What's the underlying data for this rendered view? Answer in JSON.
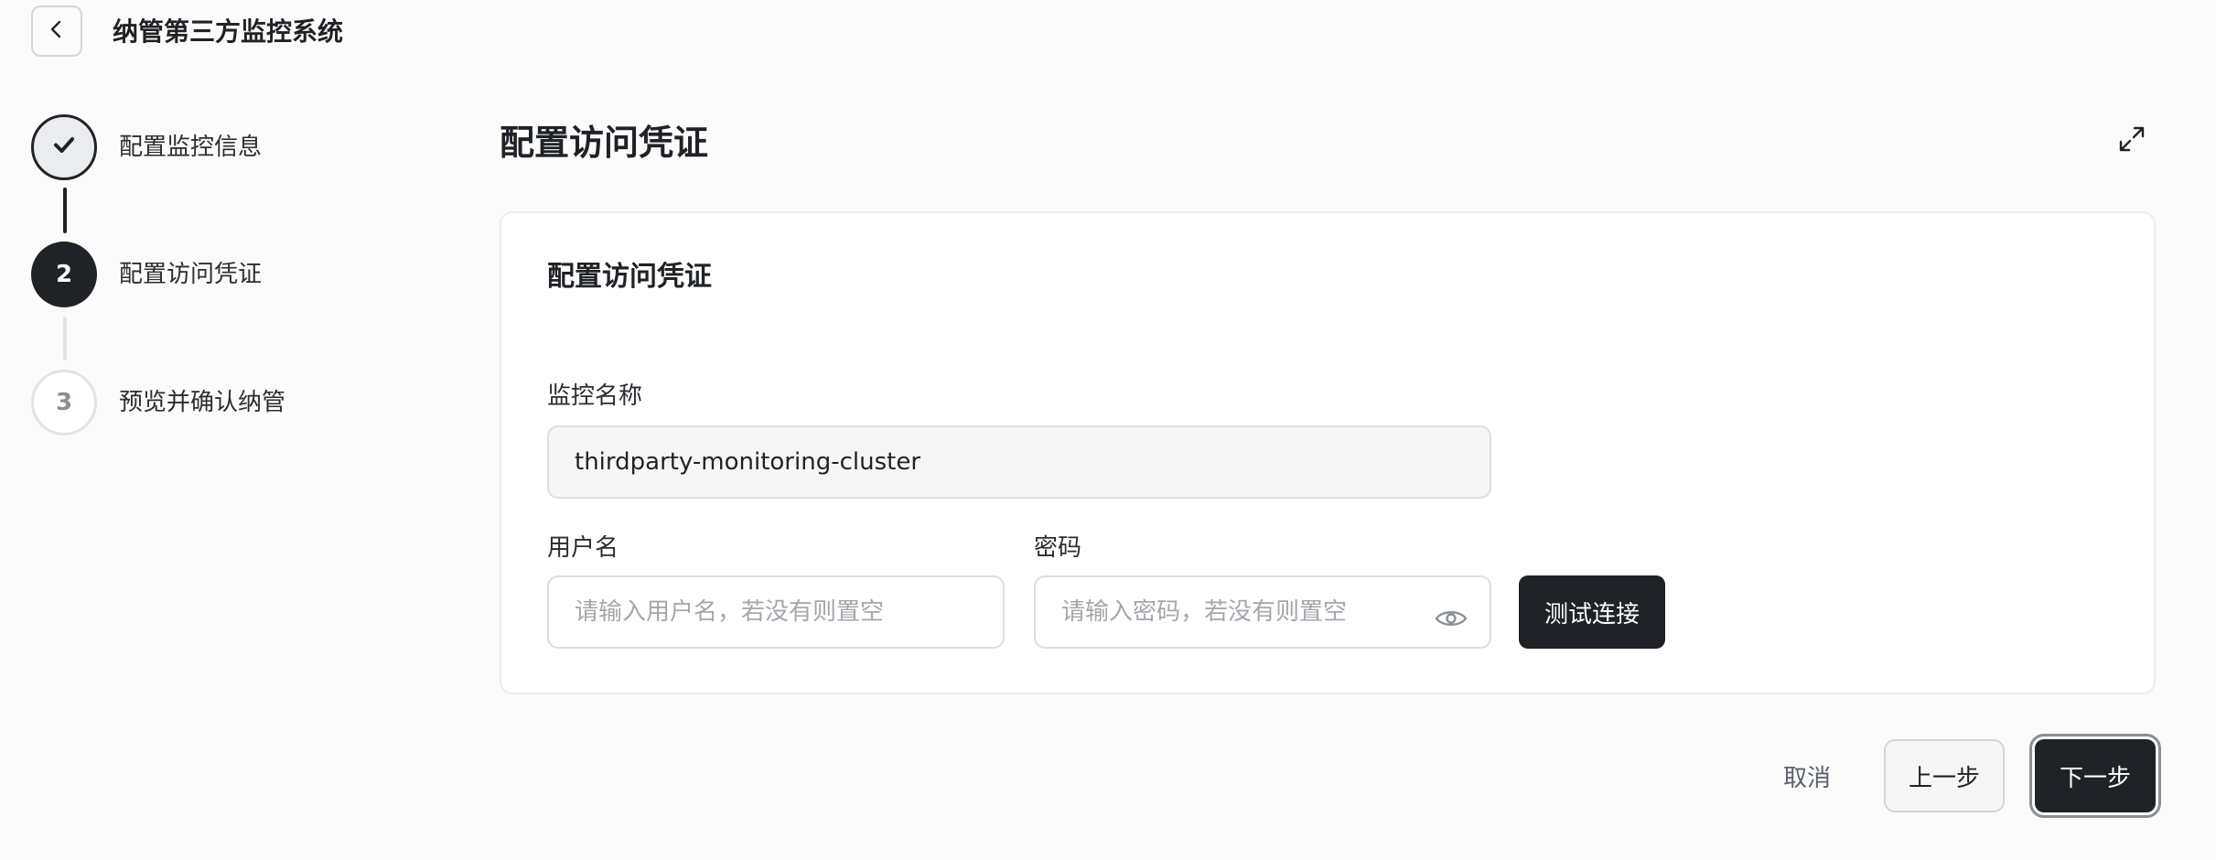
{
  "header": {
    "back_icon": "chevron-left-icon",
    "title": "纳管第三方监控系统"
  },
  "stepper": {
    "steps": [
      {
        "number": "1",
        "label": "配置监控信息",
        "status": "completed",
        "icon": "check-icon"
      },
      {
        "number": "2",
        "label": "配置访问凭证",
        "status": "active"
      },
      {
        "number": "3",
        "label": "预览并确认纳管",
        "status": "pending"
      }
    ]
  },
  "main": {
    "title": "配置访问凭证",
    "expand_icon": "expand-icon",
    "card": {
      "title": "配置访问凭证",
      "monitor_name": {
        "label": "监控名称",
        "value": "thirdparty-monitoring-cluster"
      },
      "username": {
        "label": "用户名",
        "value": "",
        "placeholder": "请输入用户名，若没有则置空"
      },
      "password": {
        "label": "密码",
        "value": "",
        "placeholder": "请输入密码，若没有则置空",
        "toggle_icon": "eye-icon"
      },
      "test_button": "测试连接"
    }
  },
  "footer": {
    "cancel_label": "取消",
    "prev_label": "上一步",
    "next_label": "下一步"
  },
  "colors": {
    "accent": "#1f2226",
    "background": "#fbfbfc",
    "border": "#dcdee2"
  }
}
